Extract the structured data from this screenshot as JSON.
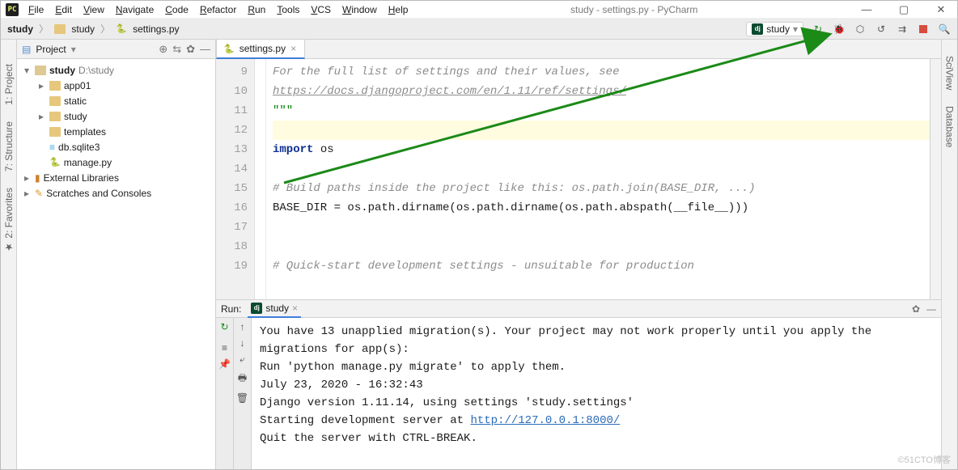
{
  "window_title": "study - settings.py - PyCharm",
  "menu": [
    "File",
    "Edit",
    "View",
    "Navigate",
    "Code",
    "Refactor",
    "Run",
    "Tools",
    "VCS",
    "Window",
    "Help"
  ],
  "breadcrumbs": [
    "study",
    "study",
    "settings.py"
  ],
  "run_config": "study",
  "toolbar_icons": [
    "run-icon",
    "debug-icon",
    "coverage-icon",
    "profile-icon",
    "attach-icon",
    "stop-icon",
    "search-icon"
  ],
  "left_tools": [
    "1: Project",
    "7: Structure",
    "2: Favorites"
  ],
  "right_tools": [
    "SciView",
    "Database"
  ],
  "project_panel": {
    "title": "Project",
    "header_icons": [
      "target-icon",
      "split-icon",
      "gear-icon",
      "minimize-icon"
    ]
  },
  "tree": [
    {
      "depth": 0,
      "t": "dir-open",
      "label": "study",
      "suffix": " D:\\study",
      "expand": "▾"
    },
    {
      "depth": 1,
      "t": "dir",
      "label": "app01",
      "expand": "▸"
    },
    {
      "depth": 1,
      "t": "dir",
      "label": "static",
      "expand": ""
    },
    {
      "depth": 1,
      "t": "dir",
      "label": "study",
      "expand": "▸"
    },
    {
      "depth": 1,
      "t": "dir",
      "label": "templates",
      "expand": ""
    },
    {
      "depth": 1,
      "t": "db",
      "label": "db.sqlite3",
      "expand": ""
    },
    {
      "depth": 1,
      "t": "py",
      "label": "manage.py",
      "expand": ""
    },
    {
      "depth": 0,
      "t": "lib",
      "label": "External Libraries",
      "expand": "▸"
    },
    {
      "depth": 0,
      "t": "scratch",
      "label": "Scratches and Consoles",
      "expand": "▸"
    }
  ],
  "editor_tab": "settings.py",
  "gutter_start": 9,
  "code_lines": [
    {
      "type": "comment",
      "text": "For the full list of settings and their values, see"
    },
    {
      "type": "link",
      "text": "https://docs.djangoproject.com/en/1.11/ref/settings/"
    },
    {
      "type": "str",
      "text": "\"\"\""
    },
    {
      "type": "blank_sel",
      "text": ""
    },
    {
      "type": "import",
      "kw": "import",
      "rest": " os"
    },
    {
      "type": "blank",
      "text": ""
    },
    {
      "type": "comment",
      "text": "# Build paths inside the project like this: os.path.join(BASE_DIR, ...)"
    },
    {
      "type": "code",
      "text": "BASE_DIR = os.path.dirname(os.path.dirname(os.path.abspath(__file__)))"
    },
    {
      "type": "blank",
      "text": ""
    },
    {
      "type": "blank",
      "text": ""
    },
    {
      "type": "comment",
      "text": "# Quick-start development settings - unsuitable for production"
    }
  ],
  "run_panel": {
    "label": "Run:",
    "tab": "study",
    "left_tool_icons": [
      "rerun-icon",
      "stop-icon",
      "toggle-icon",
      "pin-icon"
    ],
    "left_tool2_icons": [
      "up-icon",
      "down-icon",
      "wrap-icon",
      "print-icon",
      "trash-icon"
    ],
    "right_icons": [
      "gear-icon",
      "minimize-icon"
    ]
  },
  "console": {
    "lines": [
      "You have 13 unapplied migration(s). Your project may not work properly until you apply the migrations for app(s):",
      "Run 'python manage.py migrate' to apply them.",
      "July 23, 2020 - 16:32:43",
      "Django version 1.11.14, using settings 'study.settings'",
      "Starting development server at ",
      "Quit the server with CTRL-BREAK."
    ],
    "server_url": "http://127.0.0.1:8000/"
  },
  "watermark": "©51CTO博客"
}
